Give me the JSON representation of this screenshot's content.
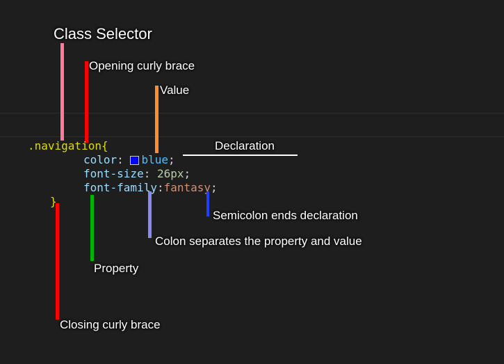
{
  "labels": {
    "classSelector": "Class Selector",
    "openingBrace": "Opening curly brace",
    "value": "Value",
    "declaration": "Declaration",
    "semicolonEnds": "Semicolon ends declaration",
    "colonSeparates": "Colon separates the property and value",
    "property": "Property",
    "closingBrace": "Closing curly brace"
  },
  "code": {
    "selector": ".navigation",
    "openBrace": "{",
    "closeBrace": "}",
    "line1": {
      "property": "color",
      "value": "blue",
      "swatch": "#0000ff"
    },
    "line2": {
      "property": "font-size",
      "value": "26px"
    },
    "line3": {
      "property": "font-family",
      "value": "fantasy"
    }
  }
}
